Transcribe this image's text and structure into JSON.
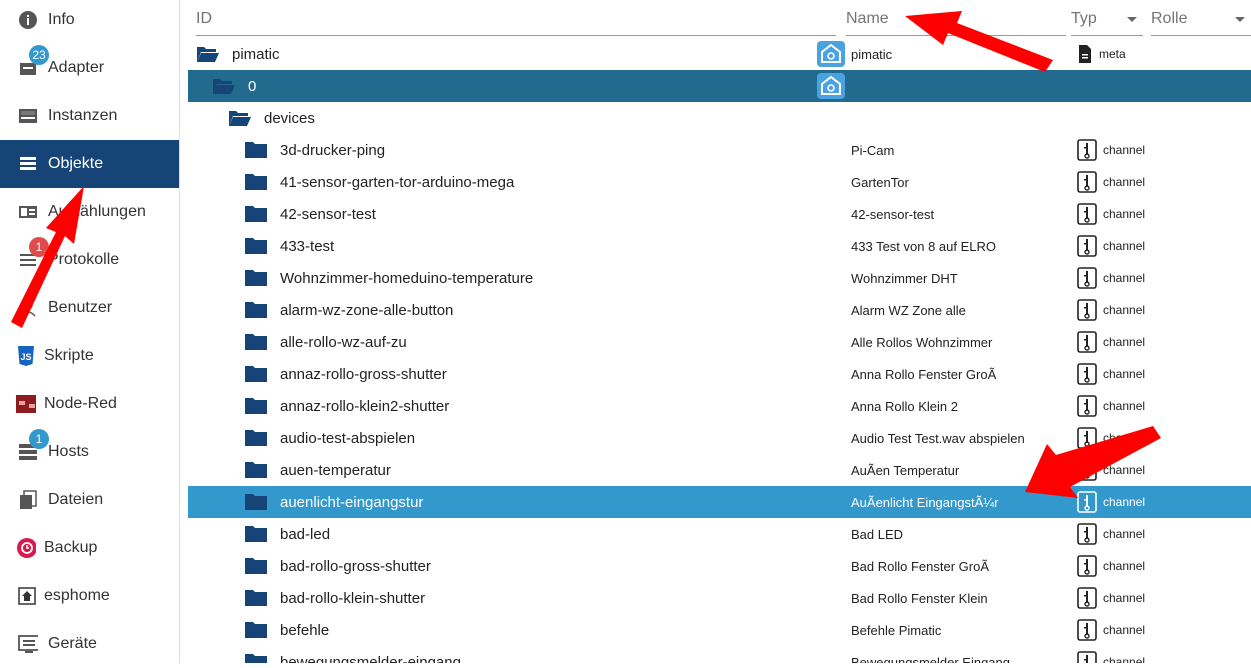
{
  "sidebar": {
    "items": [
      {
        "label": "Info",
        "icon": "info-icon"
      },
      {
        "label": "Adapter",
        "icon": "adapter-icon",
        "badge": "23"
      },
      {
        "label": "Instanzen",
        "icon": "instances-icon"
      },
      {
        "label": "Objekte",
        "icon": "objects-icon",
        "active": true
      },
      {
        "label": "Aufzählungen",
        "icon": "enums-icon"
      },
      {
        "label": "Protokolle",
        "icon": "logs-icon",
        "badge": "1"
      },
      {
        "label": "Benutzer",
        "icon": "user-icon"
      },
      {
        "label": "Skripte",
        "icon": "js-icon"
      },
      {
        "label": "Node-Red",
        "icon": "nodered-icon"
      },
      {
        "label": "Hosts",
        "icon": "hosts-icon",
        "badge": "1"
      },
      {
        "label": "Dateien",
        "icon": "files-icon"
      },
      {
        "label": "Backup",
        "icon": "backup-icon"
      },
      {
        "label": "esphome",
        "icon": "esphome-icon"
      },
      {
        "label": "Geräte",
        "icon": "devices-icon"
      }
    ]
  },
  "filters": {
    "id_placeholder": "ID",
    "name_placeholder": "Name",
    "type_placeholder": "Typ",
    "role_placeholder": "Rolle"
  },
  "tree": {
    "root": {
      "id": "pimatic",
      "name": "pimatic",
      "type": "meta"
    },
    "instance": {
      "id": "0"
    },
    "group": {
      "id": "devices"
    },
    "devices": [
      {
        "id": "3d-drucker-ping",
        "name": "Pi-Cam",
        "type": "channel"
      },
      {
        "id": "41-sensor-garten-tor-arduino-mega",
        "name": "GartenTor",
        "type": "channel"
      },
      {
        "id": "42-sensor-test",
        "name": "42-sensor-test",
        "type": "channel"
      },
      {
        "id": "433-test",
        "name": "433 Test von 8 auf ELRO",
        "type": "channel"
      },
      {
        "id": "Wohnzimmer-homeduino-temperature",
        "name": "Wohnzimmer DHT",
        "type": "channel"
      },
      {
        "id": "alarm-wz-zone-alle-button",
        "name": "Alarm WZ Zone alle",
        "type": "channel"
      },
      {
        "id": "alle-rollo-wz-auf-zu",
        "name": "Alle Rollos Wohnzimmer",
        "type": "channel"
      },
      {
        "id": "annaz-rollo-gross-shutter",
        "name": "Anna Rollo Fenster GroÃ",
        "type": "channel"
      },
      {
        "id": "annaz-rollo-klein2-shutter",
        "name": "Anna Rollo Klein 2",
        "type": "channel"
      },
      {
        "id": "audio-test-abspielen",
        "name": "Audio Test Test.wav abspielen",
        "type": "channel"
      },
      {
        "id": "auen-temperatur",
        "name": "AuÃen Temperatur",
        "type": "channel"
      },
      {
        "id": "auenlicht-eingangstur",
        "name": "AuÃenlicht EingangstÃ¼r",
        "type": "channel",
        "selected": true
      },
      {
        "id": "bad-led",
        "name": "Bad LED",
        "type": "channel"
      },
      {
        "id": "bad-rollo-gross-shutter",
        "name": "Bad Rollo Fenster GroÃ",
        "type": "channel"
      },
      {
        "id": "bad-rollo-klein-shutter",
        "name": "Bad Rollo Fenster Klein",
        "type": "channel"
      },
      {
        "id": "befehle",
        "name": "Befehle Pimatic",
        "type": "channel"
      },
      {
        "id": "bewegungsmelder-eingang",
        "name": "Bewegungsmelder  Eingang",
        "type": "channel"
      }
    ]
  },
  "colors": {
    "sidebar_active": "#164477",
    "row_selected": "#3399cc",
    "row_instance": "#236b8e",
    "folder": "#164477",
    "arrow": "#ff0000"
  }
}
